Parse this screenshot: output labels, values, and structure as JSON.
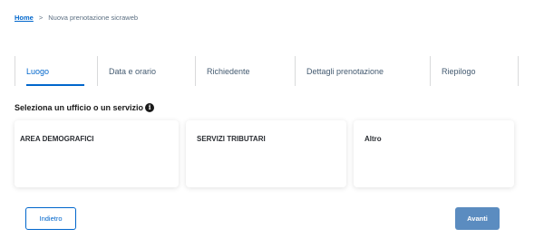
{
  "breadcrumb": {
    "home": "Home",
    "separator": ">",
    "current": "Nuova prenotazione sicraweb"
  },
  "steps": [
    {
      "label": "Luogo",
      "active": true
    },
    {
      "label": "Data e orario",
      "active": false
    },
    {
      "label": "Richiedente",
      "active": false
    },
    {
      "label": "Dettagli prenotazione",
      "active": false
    },
    {
      "label": "Riepilogo",
      "active": false
    }
  ],
  "prompt": {
    "text": "Seleziona un ufficio o un servizio",
    "icon": "info-icon"
  },
  "cards": [
    {
      "label": "AREA DEMOGRAFICI"
    },
    {
      "label": "SERVIZI TRIBUTARI"
    },
    {
      "label": "Altro"
    }
  ],
  "buttons": {
    "back": "Indietro",
    "next": "Avanti"
  },
  "colors": {
    "accent": "#0066cc",
    "next_button": "#5b8cc0",
    "divider": "#d9dadb"
  }
}
